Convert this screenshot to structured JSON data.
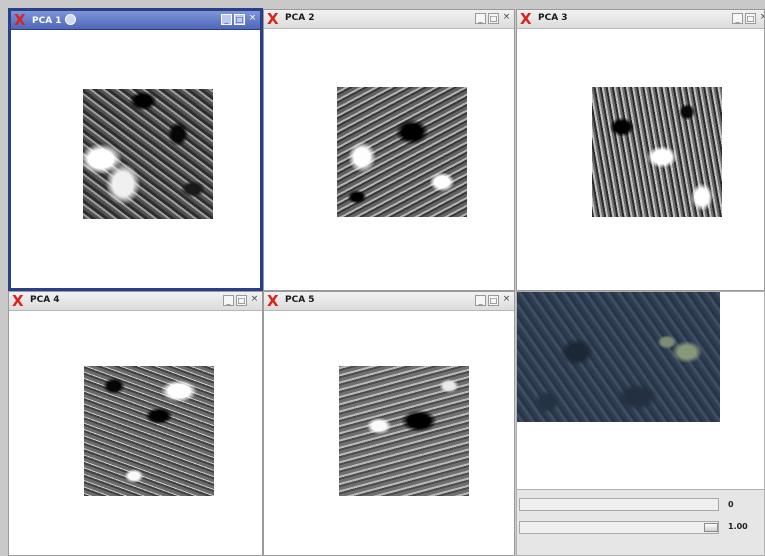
{
  "windows": [
    {
      "title": "PCA 1",
      "active": true
    },
    {
      "title": "PCA 2",
      "active": false
    },
    {
      "title": "PCA 3",
      "active": false
    },
    {
      "title": "PCA 4",
      "active": false
    },
    {
      "title": "PCA 5",
      "active": false
    }
  ],
  "controls": {
    "minimize": "_",
    "maximize": "□",
    "close": "×"
  },
  "logo_glyph": "X",
  "sliders": [
    {
      "value_label": "0",
      "value": 0.0
    },
    {
      "value_label": "1.00",
      "value": 1.0
    }
  ],
  "colors": {
    "active_border": "#2a3f86",
    "logo": "#d8231f"
  }
}
